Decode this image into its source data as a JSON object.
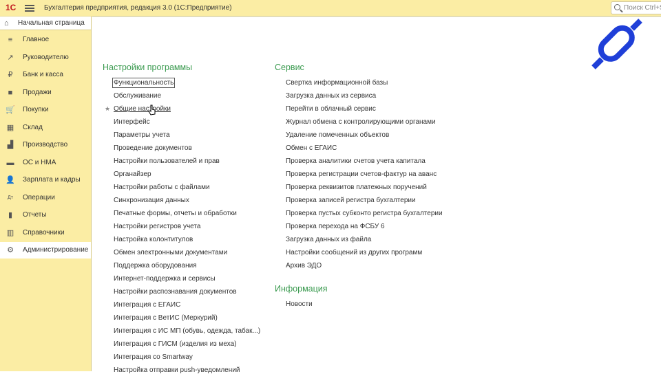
{
  "window": {
    "logo": "1С",
    "title": "Бухгалтерия предприятия, редакция 3.0  (1С:Предприятие)",
    "search_placeholder": "Поиск Ctrl+Shift+F"
  },
  "home_tab": {
    "label": "Начальная страница"
  },
  "sidebar": {
    "items": [
      {
        "label": "Главное",
        "icon": "list-icon",
        "glyph": "≡"
      },
      {
        "label": "Руководителю",
        "icon": "trend-icon",
        "glyph": "↗"
      },
      {
        "label": "Банк и касса",
        "icon": "coin-icon",
        "glyph": "₽"
      },
      {
        "label": "Продажи",
        "icon": "bag-icon",
        "glyph": "■"
      },
      {
        "label": "Покупки",
        "icon": "cart-icon",
        "glyph": "🛒"
      },
      {
        "label": "Склад",
        "icon": "warehouse-icon",
        "glyph": "▦"
      },
      {
        "label": "Производство",
        "icon": "factory-icon",
        "glyph": "▟"
      },
      {
        "label": "ОС и НМА",
        "icon": "truck-icon",
        "glyph": "▬"
      },
      {
        "label": "Зарплата и кадры",
        "icon": "person-icon",
        "glyph": "👤"
      },
      {
        "label": "Операции",
        "icon": "operations-icon",
        "glyph": "Дт"
      },
      {
        "label": "Отчеты",
        "icon": "reports-icon",
        "glyph": "▮"
      },
      {
        "label": "Справочники",
        "icon": "books-icon",
        "glyph": "▥"
      },
      {
        "label": "Администрирование",
        "icon": "gear-icon",
        "glyph": "⚙",
        "active": true
      }
    ]
  },
  "settings": {
    "title": "Настройки программы",
    "items": [
      "Функциональность",
      "Обслуживание",
      "Общие настройки",
      "Интерфейс",
      "Параметры учета",
      "Проведение документов",
      "Настройки пользователей и прав",
      "Органайзер",
      "Настройки работы с файлами",
      "Синхронизация данных",
      "Печатные формы, отчеты и обработки",
      "Настройки регистров учета",
      "Настройка колонтитулов",
      "Обмен электронными документами",
      "Поддержка оборудования",
      "Интернет-поддержка и сервисы",
      "Настройки распознавания документов",
      "Интеграция с ЕГАИС",
      "Интеграция с ВетИС (Меркурий)",
      "Интеграция с ИС МП (обувь, одежда, табак...)",
      "Интеграция с ГИСМ (изделия из меха)",
      "Интеграция со Smartway",
      "Настройка отправки push-уведомлений"
    ]
  },
  "service": {
    "title": "Сервис",
    "items": [
      "Свертка информационной базы",
      "Загрузка данных из сервиса",
      "Перейти в облачный сервис",
      "Журнал обмена с контролирующими органами",
      "Удаление помеченных объектов",
      "Обмен с ЕГАИС",
      "Проверка аналитики счетов учета капитала",
      "Проверка регистрации счетов-фактур на аванс",
      "Проверка реквизитов платежных поручений",
      "Проверка записей регистра бухгалтерии",
      "Проверка пустых субконто регистра бухгалтерии",
      "Проверка перехода на ФСБУ 6",
      "Загрузка данных из файла",
      "Настройки сообщений из других программ",
      "Архив ЭДО"
    ]
  },
  "info": {
    "title": "Информация",
    "items": [
      "Новости"
    ]
  },
  "colors": {
    "sidebar_bg": "#fbeda4",
    "section_title": "#3a9a4f",
    "brand_blue": "#1f3fd8"
  }
}
